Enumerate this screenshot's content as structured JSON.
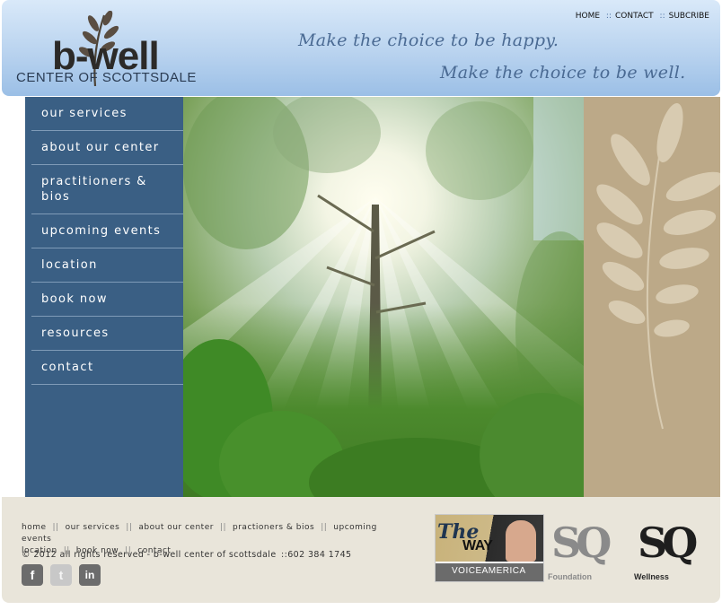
{
  "header": {
    "logo_main": "b-well",
    "logo_sub": "CENTER OF SCOTTSDALE",
    "tagline_1": "Make the choice to be happy.",
    "tagline_2": "Make the choice to be well.",
    "top_links": [
      "HOME",
      "CONTACT",
      "SUBCRIBE"
    ],
    "top_sep": "::"
  },
  "sidebar": {
    "items": [
      {
        "label": "our services"
      },
      {
        "label": "about our center"
      },
      {
        "label": "practitioners & bios"
      },
      {
        "label": "upcoming events"
      },
      {
        "label": "location"
      },
      {
        "label": "book now"
      },
      {
        "label": "resources"
      },
      {
        "label": "contact"
      }
    ]
  },
  "hero": {
    "alt": "sunlight through forest trees"
  },
  "footer": {
    "links": [
      "home",
      "our services",
      "about our center",
      "practioners & bios",
      "upcoming events",
      "location",
      "book now",
      "contact"
    ],
    "sep": "||",
    "copyright": "© 2012 all rights reserved - b-well center of scottsdale",
    "phone_sep": "::",
    "phone": "602 384 1745",
    "social": [
      "facebook-icon",
      "twitter-icon",
      "linkedin-icon"
    ],
    "theway": {
      "title": "The",
      "way": "WAY",
      "network": "VOICEAMERICA"
    },
    "sq_foundation": {
      "letters": "SQ",
      "label": "Foundation"
    },
    "sq_wellness": {
      "letters": "SQ",
      "label": "Wellness"
    }
  },
  "colors": {
    "header_bg": "#b9d3ef",
    "nav_bg": "#3a5f84",
    "tan_panel": "#bca988",
    "footer_bg": "#e9e5da",
    "tagline": "#4a6a93"
  }
}
